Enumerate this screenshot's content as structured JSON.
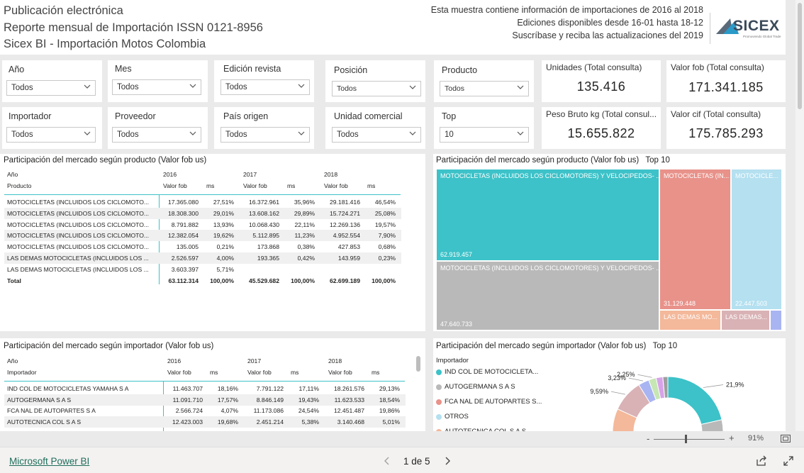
{
  "header": {
    "line1": "Publicación electrónica",
    "line2": "Reporte mensual de Importación ISSN 0121-8956",
    "line3": "Sicex BI - Importación Motos Colombia",
    "info1": "Esta muestra contiene información de importaciones de 2016 al 2018",
    "info2": "Ediciones disponibles desde 16-01 hasta 18-12",
    "info3": "Suscríbase y reciba las actualizaciones del 2019",
    "logo_text": "SICEX",
    "logo_tagline": "Promoviendo Global Trade"
  },
  "filters": {
    "anio": {
      "label": "Año",
      "value": "Todos"
    },
    "mes": {
      "label": "Mes",
      "value": "Todos"
    },
    "edicion": {
      "label": "Edición revista",
      "value": "Todos"
    },
    "posicion": {
      "label": "Posición",
      "value": "Todos"
    },
    "producto": {
      "label": "Producto",
      "value": "Todos"
    },
    "importador": {
      "label": "Importador",
      "value": "Todos"
    },
    "proveedor": {
      "label": "Proveedor",
      "value": "Todos"
    },
    "pais": {
      "label": "País origen",
      "value": "Todos"
    },
    "unidad": {
      "label": "Unidad comercial",
      "value": "Todos"
    },
    "top": {
      "label": "Top",
      "value": "10"
    }
  },
  "kpis": {
    "unidades": {
      "title": "Unidades (Total consulta)",
      "value": "135.416"
    },
    "valor_fob": {
      "title": "Valor fob (Total consulta)",
      "value": "171.341.185"
    },
    "peso": {
      "title": "Peso Bruto kg (Total consul...",
      "value": "15.655.822"
    },
    "valor_cif": {
      "title": "Valor cif (Total consulta)",
      "value": "175.785.293"
    }
  },
  "matrix_producto": {
    "title": "Participación del mercado según producto (Valor fob us)",
    "hdr_anio": "Año",
    "hdr_producto": "Producto",
    "years": [
      "2016",
      "2017",
      "2018"
    ],
    "sub_fob": "Valor fob",
    "sub_ms": "ms",
    "rows": [
      {
        "name": "MOTOCICLETAS (INCLUIDOS LOS CICLOMOTO...",
        "v": [
          "17.365.080",
          "27,51%",
          "16.372.961",
          "35,96%",
          "29.181.416",
          "46,54%"
        ]
      },
      {
        "name": "MOTOCICLETAS (INCLUIDOS LOS CICLOMOTO...",
        "v": [
          "18.308.300",
          "29,01%",
          "13.608.162",
          "29,89%",
          "15.724.271",
          "25,08%"
        ]
      },
      {
        "name": "MOTOCICLETAS (INCLUIDOS LOS CICLOMOTO...",
        "v": [
          "8.791.882",
          "13,93%",
          "10.068.430",
          "22,11%",
          "12.269.136",
          "19,57%"
        ]
      },
      {
        "name": "MOTOCICLETAS (INCLUIDOS LOS CICLOMOTO...",
        "v": [
          "12.382.054",
          "19,62%",
          "5.112.895",
          "11,23%",
          "4.952.554",
          "7,90%"
        ]
      },
      {
        "name": "MOTOCICLETAS (INCLUIDOS LOS CICLOMOTO...",
        "v": [
          "135.005",
          "0,21%",
          "173.868",
          "0,38%",
          "427.853",
          "0,68%"
        ]
      },
      {
        "name": "LAS DEMAS MOTOCICLETAS (INCLUIDOS LOS ...",
        "v": [
          "2.526.597",
          "4,00%",
          "193.365",
          "0,42%",
          "143.959",
          "0,23%"
        ]
      },
      {
        "name": "LAS DEMAS MOTOCICLETAS (INCLUIDOS LOS ...",
        "v": [
          "3.603.397",
          "5,71%",
          "",
          "",
          "",
          ""
        ]
      }
    ],
    "total": {
      "name": "Total",
      "v": [
        "63.112.314",
        "100,00%",
        "45.529.682",
        "100,00%",
        "62.699.189",
        "100,00%"
      ]
    }
  },
  "treemap_producto": {
    "title": "Participación del mercado según producto (Valor fob us)",
    "top": "Top 10",
    "tiles": [
      {
        "label": "MOTOCICLETAS (INCLUIDOS LOS CICLOMOTORES) Y VELOCIPEDOS- ...",
        "value": "62.919.457",
        "color": "#3cc2c8"
      },
      {
        "label": "MOTOCICLETAS (INCLUIDOS LOS CICLOMOTORES) Y VELOCIPEDOS- ...",
        "value": "47.640.733",
        "color": "#b9b9b9"
      },
      {
        "label": "MOTOCICLETAS (IN...",
        "value": "31.129.448",
        "color": "#e8928a"
      },
      {
        "label": "MOTOCICLE...",
        "value": "22.447.503",
        "color": "#b4e0f0"
      },
      {
        "label": "LAS DEMAS MO...",
        "value": "",
        "color": "#f4b89a"
      },
      {
        "label": "LAS DEMAS...",
        "value": "",
        "color": "#d9b2b5"
      },
      {
        "label": "",
        "value": "",
        "color": "#a9b4f2"
      }
    ]
  },
  "matrix_importador": {
    "title": "Participación del mercado según importador (Valor fob us)",
    "hdr_anio": "Año",
    "hdr_importador": "Importador",
    "years": [
      "2016",
      "2017",
      "2018"
    ],
    "sub_fob": "Valor fob",
    "sub_ms": "ms",
    "rows": [
      {
        "name": "IND COL DE MOTOCICLETAS YAMAHA S A",
        "v": [
          "11.463.707",
          "18,16%",
          "7.791.122",
          "17,11%",
          "18.261.576",
          "29,13%"
        ]
      },
      {
        "name": "AUTOGERMANA S A S",
        "v": [
          "11.091.710",
          "17,57%",
          "8.846.149",
          "19,43%",
          "11.623.533",
          "18,54%"
        ]
      },
      {
        "name": "FCA NAL DE AUTOPARTES S A",
        "v": [
          "2.566.724",
          "4,07%",
          "11.173.086",
          "24,54%",
          "12.451.487",
          "19,86%"
        ]
      },
      {
        "name": "AUTOTECNICA COL S A S",
        "v": [
          "12.423.003",
          "19,68%",
          "2.451.214",
          "5,38%",
          "3.140.468",
          "5,01%"
        ]
      }
    ]
  },
  "donut_importador": {
    "title": "Participación del mercado según importador (Valor fob us)",
    "top": "Top 10",
    "legend_title": "Importador",
    "legend": [
      {
        "name": "IND COL DE MOTOCICLETA...",
        "color": "#3cc2c8"
      },
      {
        "name": "AUTOGERMANA S A S",
        "color": "#b9b9b9"
      },
      {
        "name": "FCA NAL DE AUTOPARTES S...",
        "color": "#e8928a"
      },
      {
        "name": "OTROS",
        "color": "#b4e0f0"
      },
      {
        "name": "AUTOTECNICA COL S A S",
        "color": "#f4b89a"
      }
    ],
    "slices": [
      {
        "pct": 21.9,
        "label": "21,9%",
        "color": "#3cc2c8"
      },
      {
        "pct": 18.0,
        "label": "",
        "color": "#b9b9b9"
      },
      {
        "pct": 17.5,
        "label": "",
        "color": "#e8928a"
      },
      {
        "pct": 15.0,
        "label": "",
        "color": "#b4e0f0"
      },
      {
        "pct": 11.0,
        "label": "",
        "color": "#f4b89a"
      },
      {
        "pct": 9.59,
        "label": "9,59%",
        "color": "#d9b2b5"
      },
      {
        "pct": 3.23,
        "label": "3,23%",
        "color": "#a9b4f2"
      },
      {
        "pct": 2.25,
        "label": "2,25%",
        "color": "#c6e6b3"
      },
      {
        "pct": 2.0,
        "label": "",
        "color": "#d7a3e8"
      },
      {
        "pct": 1.5,
        "label": "",
        "color": "#9e9e9e"
      }
    ]
  },
  "zoom": {
    "minus": "-",
    "plus": "+",
    "level": "91%"
  },
  "footer": {
    "brand": "Microsoft Power BI",
    "page": "1 de 5"
  }
}
